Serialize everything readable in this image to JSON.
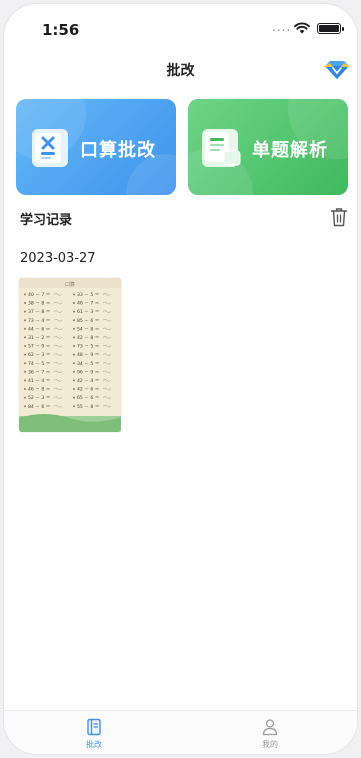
{
  "status_bar": {
    "time": "1:56",
    "signal": "...."
  },
  "header": {
    "title": "批改"
  },
  "feature_cards": [
    {
      "label": "口算批改",
      "accent": "#3f93ee"
    },
    {
      "label": "单题解析",
      "accent": "#3fb95e"
    }
  ],
  "records": {
    "section_title": "学习记录",
    "groups": [
      {
        "date": "2023-03-27",
        "items": [
          {
            "kind": "worksheet-photo"
          }
        ]
      }
    ]
  },
  "tab_bar": {
    "tabs": [
      {
        "label": "批改",
        "icon": "book-icon",
        "active": true,
        "color": "#4a90e2"
      },
      {
        "label": "我的",
        "icon": "user-icon",
        "active": false,
        "color": "#9a9a9f"
      }
    ]
  },
  "worksheet": {
    "header": "口算",
    "left": [
      "40 － 7 ＝",
      "38 － 8 ＝",
      "37 － 8 ＝",
      "73 － 4 ＝",
      "44 － 6 ＝",
      "31 － 2 ＝",
      "57 － 9 ＝",
      "62 － 3 ＝",
      "74 － 5 ＝",
      "36 － 7 ＝",
      "41 － 4 ＝",
      "46 － 8 ＝",
      "52 － 3 ＝",
      "84 － 6 ＝"
    ],
    "right": [
      "33 － 5 ＝",
      "46 － 7 ＝",
      "61 － 3 ＝",
      "85 － 6 ＝",
      "54 － 8 ＝",
      "42 － 8 ＝",
      "73 － 5 ＝",
      "48 － 9 ＝",
      "34 － 5 ＝",
      "96 － 9 ＝",
      "42 － 4 ＝",
      "42 － 6 ＝",
      "65 － 6 ＝",
      "55 － 8 ＝"
    ]
  }
}
